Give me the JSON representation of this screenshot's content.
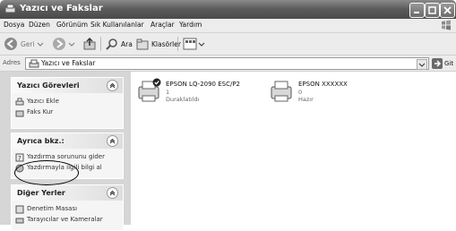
{
  "window": {
    "title": "Yazıcı ve Fakslar"
  },
  "menu": [
    "Dosya",
    "Düzen",
    "Görünüm",
    "Sık Kullanılanlar",
    "Araçlar",
    "Yardım"
  ],
  "toolbar": {
    "back": "Geri",
    "search": "Ara",
    "folders": "Klasörler"
  },
  "address": {
    "label": "Adres",
    "value": "Yazıcı ve Fakslar",
    "go": "Git"
  },
  "tasks": {
    "printer_tasks": {
      "title": "Yazıcı Görevleri",
      "items": [
        "Yazıcı Ekle",
        "Faks Kur"
      ]
    },
    "see_also": {
      "title": "Ayrıca bkz.:",
      "items": [
        "Yazdırma sorununu gider",
        "Yazdırmayla ilgili bilgi al"
      ]
    },
    "other_places": {
      "title": "Diğer Yerler",
      "items": [
        "Denetim Masası",
        "Tarayıcılar ve Kameralar"
      ]
    }
  },
  "printers": [
    {
      "name": "EPSON LQ-2090 ESC/P2",
      "count": "1",
      "status": "Duraklatıldı",
      "default": true
    },
    {
      "name": "EPSON XXXXXX",
      "count": "0",
      "status": "Hazır",
      "default": false
    }
  ]
}
